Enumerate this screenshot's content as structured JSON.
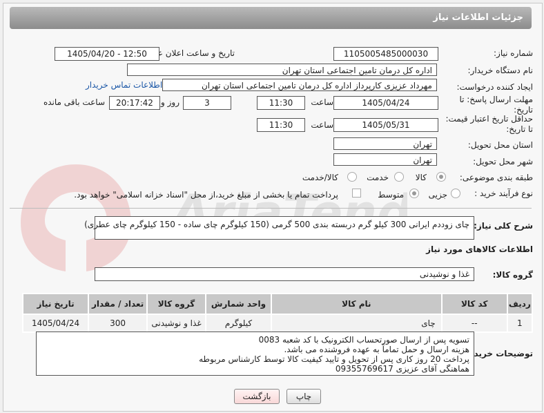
{
  "header": {
    "title": "جزئیات اطلاعات نیاز"
  },
  "fields": {
    "need_number_label": "شماره نیاز:",
    "need_number": "1105005485000030",
    "announce_label": "تاریخ و ساعت اعلان عمومی:",
    "announce_value": "1405/04/20 - 12:50",
    "buyer_org_label": "نام دستگاه خریدار:",
    "buyer_org": "اداره کل درمان تامین اجتماعی استان تهران",
    "creator_label": "ایجاد کننده درخواست:",
    "creator": "مهرداد عزیزی کارپرداز اداره کل درمان تامین اجتماعی استان تهران",
    "buyer_contact_link": "اطلاعات تماس خریدار",
    "reply_deadline_label": "مهلت ارسال پاسخ: تا تاریخ:",
    "reply_date": "1405/04/24",
    "time_label": "ساعت",
    "reply_time": "11:30",
    "days": "3",
    "days_label": "روز و",
    "remaining": "20:17:42",
    "remaining_label": "ساعت باقی مانده",
    "price_validity_label": "حداقل تاریخ اعتبار قیمت: تا تاریخ:",
    "price_date": "1405/05/31",
    "price_time": "11:30",
    "province_label": "استان محل تحویل:",
    "province": "تهران",
    "city_label": "شهر محل تحویل:",
    "city": "تهران",
    "category_label": "طبقه بندی موضوعی:",
    "category_options": [
      "کالا",
      "خدمت",
      "کالا/خدمت"
    ],
    "process_label": "نوع فرآیند خرید :",
    "process_options": [
      "جزیی",
      "متوسط"
    ],
    "payment_note": "پرداخت تمام یا بخشی از مبلغ خرید،از محل \"اسناد خزانه اسلامی\" خواهد بود."
  },
  "description": {
    "label": "شرح کلی نیاز:",
    "text": "چای زوددم ایرانی 300 کیلو گرم دربسته بندی 500 گرمی (150 کیلوگرم چای ساده - 150 کیلوگرم چای عطری)"
  },
  "goods": {
    "section_title": "اطلاعات کالاهای مورد نیاز",
    "group_label": "گروه کالا:",
    "group_value": "غذا و نوشیدنی",
    "columns": [
      "ردیف",
      "کد کالا",
      "نام کالا",
      "واحد شمارش",
      "گروه کالا",
      "تعداد / مقدار",
      "تاریخ نیاز"
    ],
    "rows": [
      [
        "1",
        "--",
        "چای",
        "کیلوگرم",
        "غذا و نوشیدنی",
        "300",
        "1405/04/24"
      ]
    ]
  },
  "buyer_notes": {
    "label": "توضیحات خریدار:",
    "line1": "تسویه پس از ارسال صورتحساب الکترونیک با کد شعبه 0083",
    "line2": "هزینه ارسال و حمل تماماً به عهده فروشنده می باشد.",
    "line3": "پرداخت 20 روز کاری پس از تحویل و تایید کیفیت کالا توسط کارشناس مربوطه",
    "line4": "هماهنگی آقای عزیزی 09355769617"
  },
  "buttons": {
    "print": "چاپ",
    "back": "بازگشت"
  },
  "colors": {
    "title_bar": "#9e9e9e",
    "link": "#1a56a6",
    "back_button": "#fde8e8"
  },
  "watermark": {
    "text": "AriaTender.net"
  }
}
